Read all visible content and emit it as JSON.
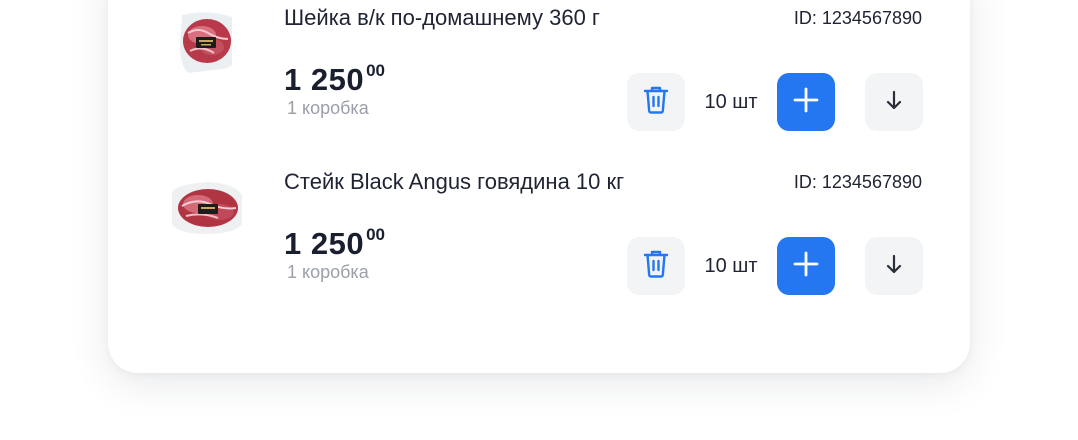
{
  "cart": {
    "items": [
      {
        "title": "Шейка в/к по-домашнему 360 г",
        "id_label": "ID: 1234567890",
        "price_int": "1 250",
        "price_cents": "00",
        "unit": "1 коробка",
        "quantity": "10 шт",
        "image": "product-photo-pork-neck"
      },
      {
        "title": "Стейк Black Angus говядина 10 кг",
        "id_label": "ID: 1234567890",
        "price_int": "1 250",
        "price_cents": "00",
        "unit": "1 коробка",
        "quantity": "10 шт",
        "image": "product-photo-beef-steak"
      }
    ],
    "icons": {
      "delete": "trash-icon",
      "add": "plus-icon",
      "more": "arrow-down-icon"
    },
    "colors": {
      "accent": "#2477f0",
      "delete_icon": "#2477f0",
      "secondary_button_bg": "#f2f4f6",
      "muted_text": "#9a9fa8"
    }
  }
}
